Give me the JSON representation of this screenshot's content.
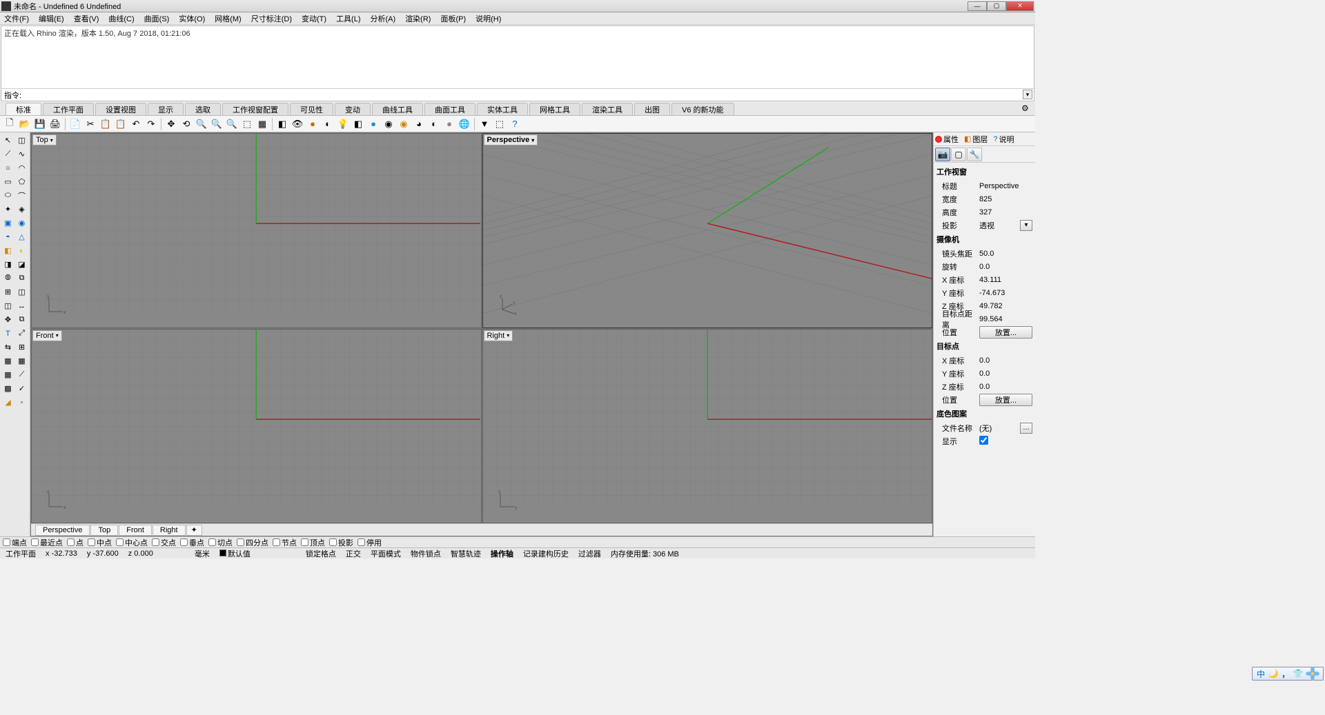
{
  "window": {
    "title": "未命名 - Undefined 6 Undefined"
  },
  "menus": [
    "文件(F)",
    "编辑(E)",
    "查看(V)",
    "曲线(C)",
    "曲面(S)",
    "实体(O)",
    "网格(M)",
    "尺寸标注(D)",
    "变动(T)",
    "工具(L)",
    "分析(A)",
    "渲染(R)",
    "面板(P)",
    "说明(H)"
  ],
  "console": {
    "line1": "正在载入 Rhino 渲染，版本 1.50, Aug  7 2018, 01:21:06",
    "cmd_label": "指令:"
  },
  "tool_tabs": [
    "标准",
    "工作平面",
    "设置视图",
    "显示",
    "选取",
    "工作视窗配置",
    "可见性",
    "变动",
    "曲线工具",
    "曲面工具",
    "实体工具",
    "网格工具",
    "渲染工具",
    "出图",
    "V6 的新功能"
  ],
  "viewport_labels": {
    "top": "Top",
    "persp": "Perspective",
    "front": "Front",
    "right": "Right"
  },
  "viewport_tabs": [
    "Perspective",
    "Top",
    "Front",
    "Right"
  ],
  "right_panel": {
    "tabs": {
      "props": "属性",
      "layers": "图层",
      "help": "说明"
    },
    "sec_viewport": "工作视窗",
    "title_k": "标题",
    "title_v": "Perspective",
    "width_k": "宽度",
    "width_v": "825",
    "height_k": "高度",
    "height_v": "327",
    "proj_k": "投影",
    "proj_v": "透视",
    "sec_camera": "摄像机",
    "lens_k": "镜头焦距",
    "lens_v": "50.0",
    "rot_k": "旋转",
    "rot_v": "0.0",
    "camx_k": "X 座标",
    "camx_v": "43.111",
    "camy_k": "Y 座标",
    "camy_v": "-74.673",
    "camz_k": "Z 座标",
    "camz_v": "49.782",
    "dist_k": "目标点距离",
    "dist_v": "99.564",
    "pos_k": "位置",
    "pos_btn": "放置...",
    "sec_target": "目标点",
    "tx_k": "X 座标",
    "tx_v": "0.0",
    "ty_k": "Y 座标",
    "ty_v": "0.0",
    "tz_k": "Z 座标",
    "tz_v": "0.0",
    "tpos_k": "位置",
    "tpos_btn": "放置...",
    "sec_wallpaper": "底色图案",
    "file_k": "文件名称",
    "file_v": "(无)",
    "show_k": "显示"
  },
  "snaps": [
    "端点",
    "最近点",
    "点",
    "中点",
    "中心点",
    "交点",
    "垂点",
    "切点",
    "四分点",
    "节点",
    "顶点",
    "投影",
    "停用"
  ],
  "status": {
    "cplane": "工作平面",
    "x": "x -32.733",
    "y": "y -37.600",
    "z": "z 0.000",
    "unit": "毫米",
    "layer": "默认值",
    "items": [
      "锁定格点",
      "正交",
      "平面模式",
      "物件锁点",
      "智慧轨迹",
      "操作轴",
      "记录建构历史",
      "过滤器"
    ],
    "mem": "内存使用量: 306 MB"
  }
}
